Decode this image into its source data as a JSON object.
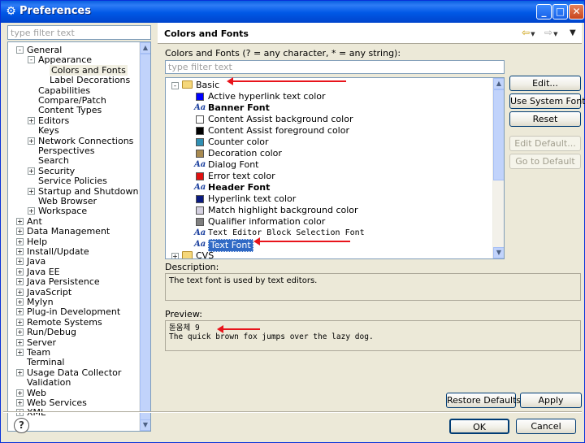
{
  "window": {
    "title": "Preferences"
  },
  "left": {
    "filter_placeholder": "type filter text",
    "tree": [
      {
        "label": "General",
        "depth": 0,
        "expander": "-"
      },
      {
        "label": "Appearance",
        "depth": 1,
        "expander": "-"
      },
      {
        "label": "Colors and Fonts",
        "depth": 2,
        "expander": "",
        "selected": true
      },
      {
        "label": "Label Decorations",
        "depth": 2,
        "expander": ""
      },
      {
        "label": "Capabilities",
        "depth": 1,
        "expander": ""
      },
      {
        "label": "Compare/Patch",
        "depth": 1,
        "expander": ""
      },
      {
        "label": "Content Types",
        "depth": 1,
        "expander": ""
      },
      {
        "label": "Editors",
        "depth": 1,
        "expander": "+"
      },
      {
        "label": "Keys",
        "depth": 1,
        "expander": ""
      },
      {
        "label": "Network Connections",
        "depth": 1,
        "expander": "+"
      },
      {
        "label": "Perspectives",
        "depth": 1,
        "expander": ""
      },
      {
        "label": "Search",
        "depth": 1,
        "expander": ""
      },
      {
        "label": "Security",
        "depth": 1,
        "expander": "+"
      },
      {
        "label": "Service Policies",
        "depth": 1,
        "expander": ""
      },
      {
        "label": "Startup and Shutdown",
        "depth": 1,
        "expander": "+"
      },
      {
        "label": "Web Browser",
        "depth": 1,
        "expander": ""
      },
      {
        "label": "Workspace",
        "depth": 1,
        "expander": "+"
      },
      {
        "label": "Ant",
        "depth": 0,
        "expander": "+"
      },
      {
        "label": "Data Management",
        "depth": 0,
        "expander": "+"
      },
      {
        "label": "Help",
        "depth": 0,
        "expander": "+"
      },
      {
        "label": "Install/Update",
        "depth": 0,
        "expander": "+"
      },
      {
        "label": "Java",
        "depth": 0,
        "expander": "+"
      },
      {
        "label": "Java EE",
        "depth": 0,
        "expander": "+"
      },
      {
        "label": "Java Persistence",
        "depth": 0,
        "expander": "+"
      },
      {
        "label": "JavaScript",
        "depth": 0,
        "expander": "+"
      },
      {
        "label": "Mylyn",
        "depth": 0,
        "expander": "+"
      },
      {
        "label": "Plug-in Development",
        "depth": 0,
        "expander": "+"
      },
      {
        "label": "Remote Systems",
        "depth": 0,
        "expander": "+"
      },
      {
        "label": "Run/Debug",
        "depth": 0,
        "expander": "+"
      },
      {
        "label": "Server",
        "depth": 0,
        "expander": "+"
      },
      {
        "label": "Team",
        "depth": 0,
        "expander": "+"
      },
      {
        "label": "Terminal",
        "depth": 0,
        "expander": ""
      },
      {
        "label": "Usage Data Collector",
        "depth": 0,
        "expander": "+"
      },
      {
        "label": "Validation",
        "depth": 0,
        "expander": ""
      },
      {
        "label": "Web",
        "depth": 0,
        "expander": "+"
      },
      {
        "label": "Web Services",
        "depth": 0,
        "expander": "+"
      },
      {
        "label": "XML",
        "depth": 0,
        "expander": "+"
      }
    ]
  },
  "right": {
    "page_title": "Colors and Fonts",
    "colors_fonts_label": "Colors and Fonts (? = any character, * = any string):",
    "filter_placeholder": "type filter text",
    "tree": [
      {
        "kind": "category",
        "label": "Basic",
        "expander": "-"
      },
      {
        "kind": "color",
        "label": "Active hyperlink text color",
        "color": "#0000ff"
      },
      {
        "kind": "font",
        "label": "Banner Font",
        "bold": true
      },
      {
        "kind": "color",
        "label": "Content Assist background color",
        "color": "#ffffff"
      },
      {
        "kind": "color",
        "label": "Content Assist foreground color",
        "color": "#000000"
      },
      {
        "kind": "color",
        "label": "Counter color",
        "color": "#2f8fb3"
      },
      {
        "kind": "color",
        "label": "Decoration color",
        "color": "#a88a50"
      },
      {
        "kind": "font",
        "label": "Dialog Font"
      },
      {
        "kind": "color",
        "label": "Error text color",
        "color": "#e01010"
      },
      {
        "kind": "font",
        "label": "Header Font",
        "bold": true
      },
      {
        "kind": "color",
        "label": "Hyperlink text color",
        "color": "#0a1a80"
      },
      {
        "kind": "color",
        "label": "Match highlight background color",
        "color": "#d4d0e0"
      },
      {
        "kind": "color",
        "label": "Qualifier information color",
        "color": "#808080"
      },
      {
        "kind": "font",
        "label": "Text Editor Block Selection Font",
        "mono": true
      },
      {
        "kind": "font",
        "label": "Text Font",
        "selected": true
      },
      {
        "kind": "category",
        "label": "CVS",
        "expander": "+"
      }
    ],
    "buttons": {
      "edit": "Edit...",
      "use_system_font": "Use System Font",
      "reset": "Reset",
      "edit_default": "Edit Default...",
      "go_to_default": "Go to Default"
    },
    "description_label": "Description:",
    "description_text": "The text font is used by text editors.",
    "preview_label": "Preview:",
    "preview_line1": "돋움체 9",
    "preview_line2": "The quick brown fox jumps over the lazy dog.",
    "restore_defaults": "Restore Defaults",
    "apply": "Apply"
  },
  "footer": {
    "ok": "OK",
    "cancel": "Cancel"
  }
}
